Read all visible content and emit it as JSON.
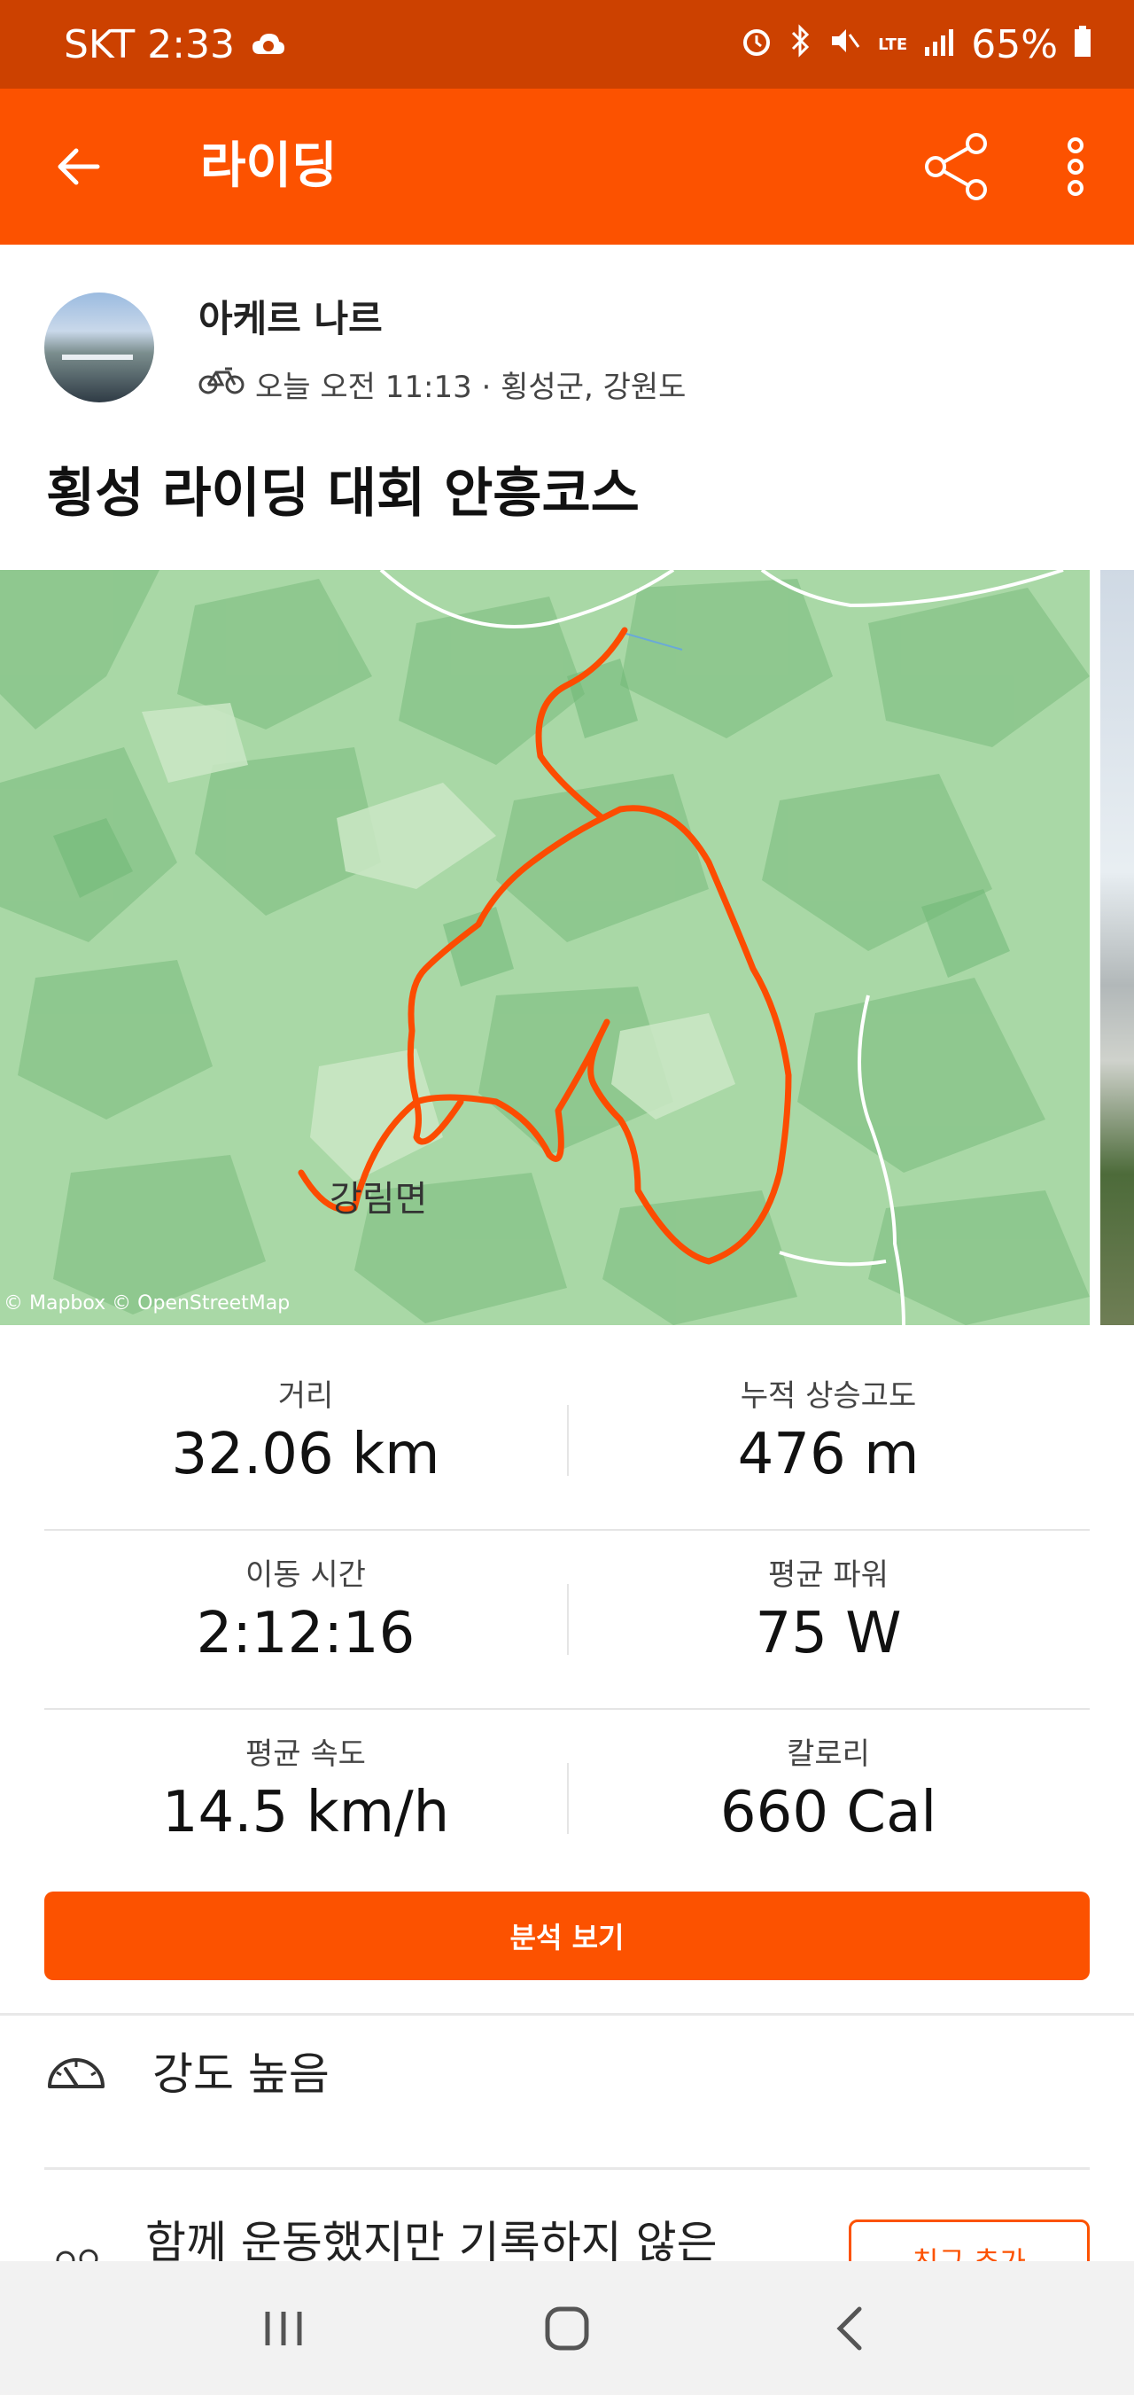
{
  "status": {
    "carrier_time": "SKT 2:33",
    "battery": "65%",
    "network": "LTE"
  },
  "appbar": {
    "title": "라이딩"
  },
  "athlete": {
    "name": "아케르 나르",
    "meta": "오늘 오전 11:13 · 횡성군, 강원도"
  },
  "activity": {
    "title": "횡성 라이딩 대회 안흥코스"
  },
  "map": {
    "place_label": "강림면",
    "attribution": "© Mapbox © OpenStreetMap"
  },
  "stats": [
    {
      "left_label": "거리",
      "left_value": "32.06 km",
      "right_label": "누적 상승고도",
      "right_value": "476 m"
    },
    {
      "left_label": "이동 시간",
      "left_value": "2:12:16",
      "right_label": "평균 파워",
      "right_value": "75 W"
    },
    {
      "left_label": "평균 속도",
      "left_value": "14.5 km/h",
      "right_label": "칼로리",
      "right_value": "660 Cal"
    }
  ],
  "actions": {
    "analysis_label": "분석 보기",
    "add_friend_label": "친구 추가"
  },
  "intensity": {
    "label": "강도 높음"
  },
  "together": {
    "label": "함께 운동했지만 기록하지 않은"
  },
  "colors": {
    "brand": "#fc5200",
    "status_bar": "#cc4100",
    "route": "#fc4c02"
  }
}
